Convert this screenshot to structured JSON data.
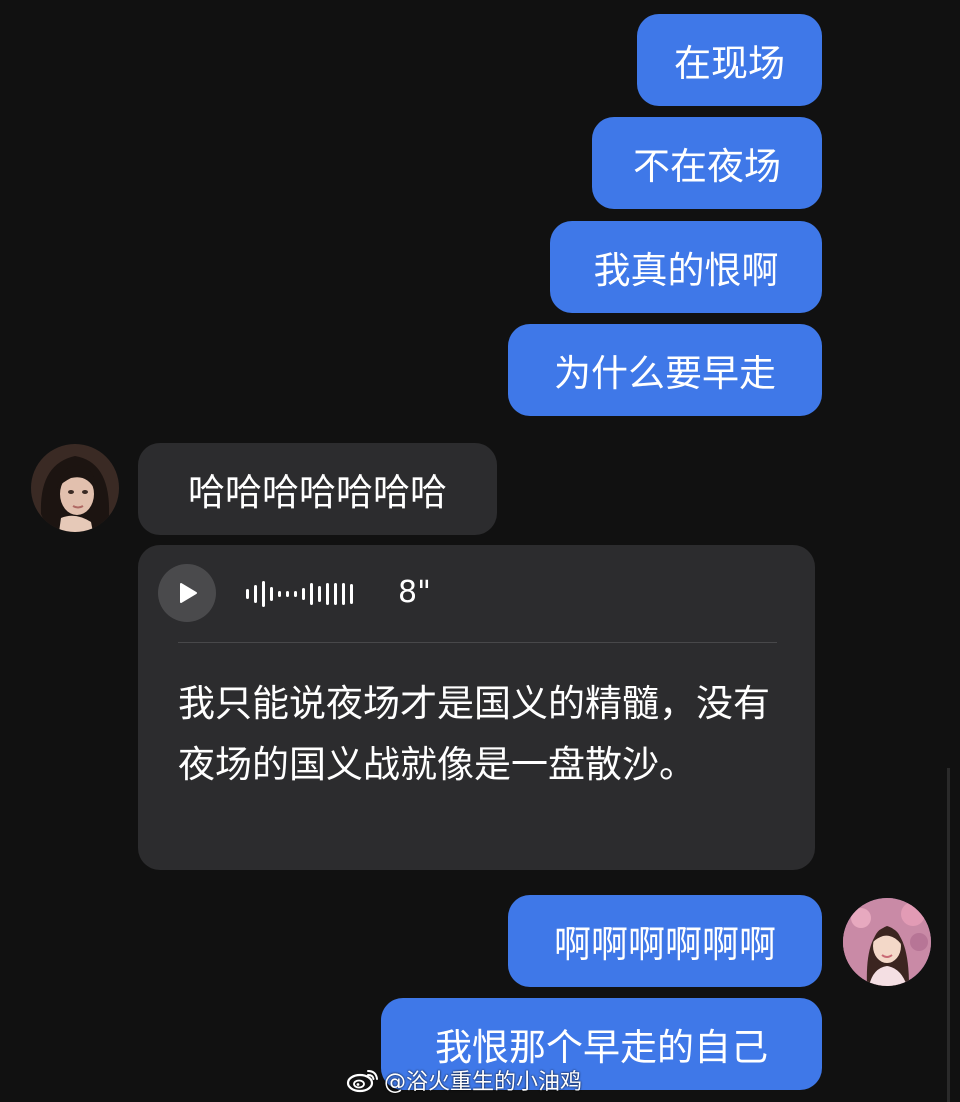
{
  "messages_out_top": [
    {
      "text": "在现场"
    },
    {
      "text": "不在夜场"
    },
    {
      "text": "我真的恨啊"
    },
    {
      "text": "为什么要早走"
    }
  ],
  "message_in_text": "哈哈哈哈哈哈哈",
  "voice_message": {
    "duration": "8\"",
    "transcript": "我只能说夜场才是国义的精髓，没有夜场的国义战就像是一盘散沙。"
  },
  "messages_out_bottom": [
    {
      "text": "啊啊啊啊啊啊"
    },
    {
      "text": "我恨那个早走的自己"
    }
  ],
  "watermark": {
    "text": "@浴火重生的小油鸡",
    "icon": "weibo-icon"
  },
  "colors": {
    "background": "#111111",
    "outgoing_bubble": "#3f78e8",
    "incoming_bubble": "#2c2c2e"
  }
}
